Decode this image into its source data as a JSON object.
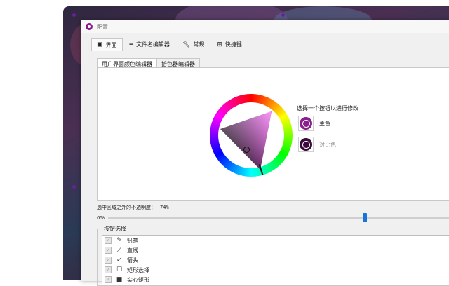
{
  "window": {
    "title": "配置"
  },
  "tabs": [
    {
      "label": "界面",
      "icon": "monitor-icon",
      "active": true
    },
    {
      "label": "文件名编辑器",
      "icon": "filename-icon",
      "active": false
    },
    {
      "label": "常规",
      "icon": "wrench-icon",
      "active": false
    },
    {
      "label": "快捷键",
      "icon": "grid-icon",
      "active": false
    }
  ],
  "subtabs": [
    {
      "label": "用户界面颜色编辑器",
      "active": true
    },
    {
      "label": "拾色器编辑器",
      "active": false
    }
  ],
  "color_editor": {
    "hint": "选择一个按钮以进行修改",
    "buttons": [
      {
        "label": "主色",
        "color": "#8a1f8f",
        "muted": false
      },
      {
        "label": "对比色",
        "color": "#3a0a3c",
        "muted": true
      }
    ]
  },
  "opacity": {
    "label": "选中区域之外的不透明度：",
    "value": "74%",
    "min_label": "0%",
    "level": 0.74
  },
  "button_selection": {
    "title": "按钮选择",
    "items": [
      {
        "label": "铅笔",
        "icon": "pencil-icon",
        "glyph": "✎"
      },
      {
        "label": "直线",
        "icon": "line-icon",
        "glyph": "⟋"
      },
      {
        "label": "箭头",
        "icon": "arrow-icon",
        "glyph": "↙"
      },
      {
        "label": "矩形选择",
        "icon": "rectangle-icon",
        "glyph": "☐"
      },
      {
        "label": "实心矩形",
        "icon": "filled-rectangle-icon",
        "glyph": "■"
      }
    ]
  },
  "colors": {
    "accent": "#8a1f8f",
    "slider": "#1a73d9",
    "selection_border": "#5b2a8a"
  }
}
